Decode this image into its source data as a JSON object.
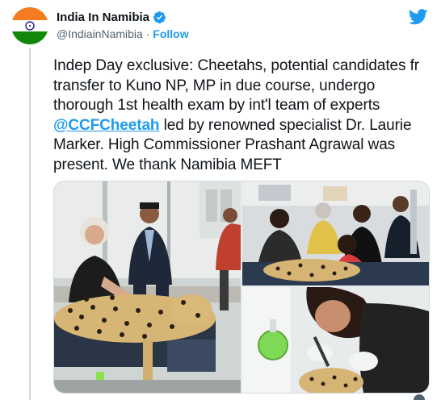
{
  "account": {
    "name": "India In Namibia",
    "handle": "@IndiainNamibia",
    "separator": "·",
    "follow_label": "Follow",
    "avatar_icon": "india-flag-avatar",
    "verified_icon": "verified-badge-icon",
    "brand_icon": "twitter-bird-icon"
  },
  "tweet": {
    "text_before": "Indep Day exclusive: Cheetahs, potential candidates fr transfer to Kuno NP, MP in due course, undergo thorough 1st health exam by int'l team of experts ",
    "mention": "@CCFCheetah",
    "text_after": " led by renowned specialist Dr. Laurie Marker. High Commissioner Prashant Agrawal was present. We thank Namibia MEFT"
  },
  "colors": {
    "accent": "#1d9bf0",
    "text": "#0f1419",
    "secondary_text": "#536471",
    "saffron": "#f47b20",
    "green": "#138808"
  },
  "media": {
    "count": 3,
    "photos": [
      "cheetah-health-exam-photo",
      "veterinary-team-photo",
      "cheetah-dental-exam-photo"
    ]
  }
}
